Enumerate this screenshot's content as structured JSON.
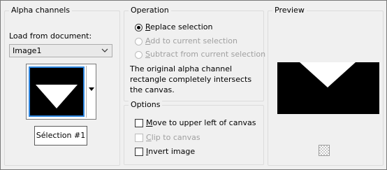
{
  "alpha_channels": {
    "title": "Alpha channels",
    "load_from_label": "Load from document:",
    "document_value": "Image1",
    "channel_tooltip": "Sélection #1"
  },
  "operation": {
    "title": "Operation",
    "replace": "Replace selection",
    "add": "Add to current selection",
    "subtract": "Subtract from current selection",
    "description": "The original alpha channel rectangle completely intersects the canvas."
  },
  "options": {
    "title": "Options",
    "move_upper_left": "Move to upper left of canvas",
    "clip": "Clip to canvas",
    "invert": "Invert image"
  },
  "preview": {
    "title": "Preview"
  },
  "colors": {
    "thumbnail_selection": "#2d86e0",
    "background": "#f0f0f0"
  }
}
